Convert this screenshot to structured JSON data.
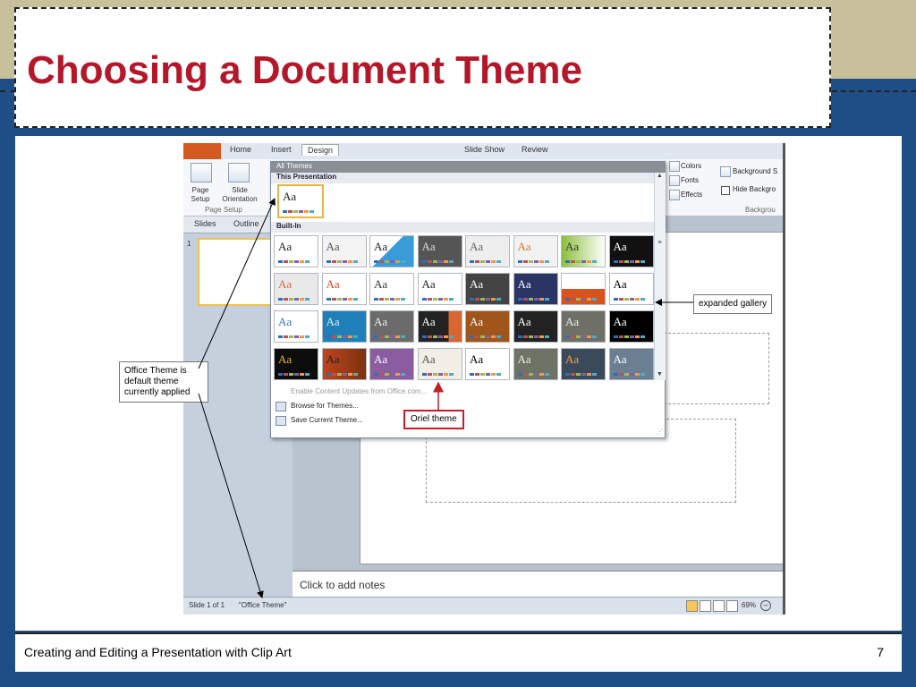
{
  "slide": {
    "title": "Choosing a Document Theme",
    "footer_left": "Creating and Editing a Presentation with Clip Art",
    "page_number": "7"
  },
  "ribbon": {
    "tabs": [
      "Home",
      "Insert",
      "Design",
      "Slide Show",
      "Review"
    ],
    "active_tab": "Design",
    "page_setup_label_1": "Page",
    "page_setup_label_2": "Setup",
    "slide_orientation_label_1": "Slide",
    "slide_orientation_label_2": "Orientation",
    "group_page_setup": "Page Setup",
    "colors": "Colors",
    "fonts": "Fonts",
    "effects": "Effects",
    "background_styles": "Background S",
    "hide_background": "Hide Backgro",
    "group_background": "Backgrou"
  },
  "panel": {
    "tab_slides": "Slides",
    "tab_outline": "Outline",
    "slide_number": "1"
  },
  "gallery": {
    "header": "All Themes",
    "section_this": "This Presentation",
    "section_builtin": "Built-In",
    "sample_text": "Aa",
    "menu_enable": "Enable Content Updates from Office.com...",
    "menu_browse": "Browse for Themes...",
    "menu_save": "Save Current Theme...",
    "accent_colors": [
      "#2f6fb7",
      "#c0504d",
      "#9bbb59",
      "#8064a2",
      "#f79646",
      "#4bacc6"
    ]
  },
  "notes": {
    "placeholder": "Click to add notes"
  },
  "status": {
    "slide_of": "Slide 1 of 1",
    "theme_name": "\"Office Theme\"",
    "zoom": "69%",
    "zoom_out": "–"
  },
  "callouts": {
    "office_theme": "Office Theme is default theme currently applied",
    "expanded_gallery": "expanded gallery",
    "oriel_theme": "Oriel theme"
  }
}
